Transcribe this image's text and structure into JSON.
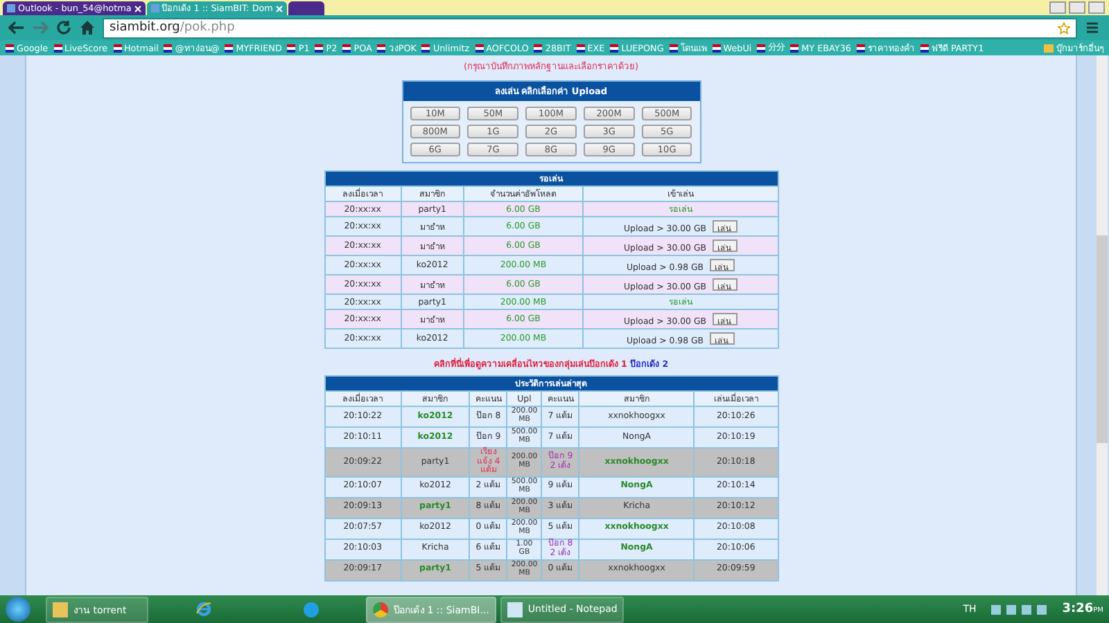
{
  "browser": {
    "tabs": [
      {
        "title": "Outlook - bun_54@hotma",
        "selected": false
      },
      {
        "title": "ป๊อกเด้ง 1 :: SiamBIT: Dom",
        "selected": true
      },
      {
        "selected": false
      }
    ],
    "url_host": "siambit.org",
    "url_path": "/pok.php",
    "bookmarks": [
      "Google",
      "LiveScore",
      "Hotmail",
      "@ทาง่อน@",
      "MYFRIEND",
      "P1",
      "P2",
      "POA",
      "วงPOK",
      "Unlimitz",
      "AOFCOLO",
      "28BIT",
      "EXE",
      "LUEPONG",
      "โดนแพ",
      "WebUi",
      "分分",
      "MY EBAY36",
      "ราคาทองคำ",
      "ฟรีดี PARTY1"
    ],
    "other_bookmarks": "บุ๊กมาร์กอื่นๆ"
  },
  "notice": "(กรุณาบันทึกภาพหลักฐานและเลือกราคาด้วย)",
  "upload_panel": {
    "title": "ลงเล่น คลิกเลือกค่า Upload",
    "options": [
      "10M",
      "50M",
      "100M",
      "200M",
      "500M",
      "800M",
      "1G",
      "2G",
      "3G",
      "5G",
      "6G",
      "7G",
      "8G",
      "9G",
      "10G"
    ]
  },
  "waiting_table": {
    "title": "รอเล่น",
    "columns": [
      "ลงเมื่อเวลา",
      "สมาชิก",
      "จำนวนค่าอัพโหลด",
      "เข้าเล่น"
    ],
    "rows": [
      {
        "time": "20:xx:xx",
        "member": "party1",
        "amount": "6.00 GB",
        "kind": "status",
        "status": "รอเล่น"
      },
      {
        "time": "20:xx:xx",
        "member": "มาธำห",
        "amount": "6.00 GB",
        "kind": "join",
        "requirement": "Upload > 30.00 GB",
        "button": "เล่น"
      },
      {
        "time": "20:xx:xx",
        "member": "มาธำห",
        "amount": "6.00 GB",
        "kind": "join",
        "requirement": "Upload > 30.00 GB",
        "button": "เล่น"
      },
      {
        "time": "20:xx:xx",
        "member": "ko2012",
        "amount": "200.00 MB",
        "kind": "join",
        "requirement": "Upload > 0.98 GB",
        "button": "เล่น"
      },
      {
        "time": "20:xx:xx",
        "member": "มาธำห",
        "amount": "6.00 GB",
        "kind": "join",
        "requirement": "Upload > 30.00 GB",
        "button": "เล่น"
      },
      {
        "time": "20:xx:xx",
        "member": "party1",
        "amount": "200.00 MB",
        "kind": "status",
        "status": "รอเล่น"
      },
      {
        "time": "20:xx:xx",
        "member": "มาธำห",
        "amount": "6.00 GB",
        "kind": "join",
        "requirement": "Upload > 30.00 GB",
        "button": "เล่น"
      },
      {
        "time": "20:xx:xx",
        "member": "ko2012",
        "amount": "200.00 MB",
        "kind": "join",
        "requirement": "Upload > 0.98 GB",
        "button": "เล่น"
      }
    ]
  },
  "group_link": {
    "text": "คลิกที่นี่เพื่อดูความเคลื่อนไหวของกลุ่มเล่นป๊อกเด้ง 1",
    "link": "ป๊อกเด้ง 2"
  },
  "history_table": {
    "title": "ประวัติการเล่นล่าสุด",
    "columns": [
      "ลงเมื่อเวลา",
      "สมาชิก",
      "คะแนน",
      "Upl",
      "คะแนน",
      "สมาชิก",
      "เล่นเมื่อเวลา"
    ],
    "rows": [
      {
        "time": "20:10:22",
        "member": "ko2012",
        "score": {
          "text": "ป๊อก 8",
          "color": "#333333"
        },
        "upload": "200.00 MB",
        "opponent_score": {
          "text": "7 แต้ม",
          "color": "#333333"
        },
        "opponent": "xxnokhoogxx",
        "played": "20:10:26",
        "member_won": true,
        "opponent_won": false,
        "highlighted": false
      },
      {
        "time": "20:10:11",
        "member": "ko2012",
        "score": {
          "text": "ป๊อก 9",
          "color": "#333333"
        },
        "upload": "500.00 MB",
        "opponent_score": {
          "text": "7 แต้ม",
          "color": "#333333"
        },
        "opponent": "NongA",
        "played": "20:10:19",
        "member_won": true,
        "opponent_won": false,
        "highlighted": false
      },
      {
        "time": "20:09:22",
        "member": "party1",
        "score": {
          "text": "เรียง แจ้ง 4 แต้ม",
          "color": "#e0305a"
        },
        "upload": "200.00 MB",
        "opponent_score": {
          "text": "ป๊อก 9 2 เด้ง",
          "color": "#a030b0"
        },
        "opponent": "xxnokhoogxx",
        "played": "20:10:18",
        "member_won": false,
        "opponent_won": true,
        "highlighted": true
      },
      {
        "time": "20:10:07",
        "member": "ko2012",
        "score": {
          "text": "2 แต้ม",
          "color": "#333333"
        },
        "upload": "500.00 MB",
        "opponent_score": {
          "text": "9 แต้ม",
          "color": "#333333"
        },
        "opponent": "NongA",
        "played": "20:10:14",
        "member_won": false,
        "opponent_won": true,
        "highlighted": false
      },
      {
        "time": "20:09:13",
        "member": "party1",
        "score": {
          "text": "8 แต้ม",
          "color": "#333333"
        },
        "upload": "200.00 MB",
        "opponent_score": {
          "text": "3 แต้ม",
          "color": "#333333"
        },
        "opponent": "Kricha",
        "played": "20:10:12",
        "member_won": true,
        "opponent_won": false,
        "highlighted": true
      },
      {
        "time": "20:07:57",
        "member": "ko2012",
        "score": {
          "text": "0 แต้ม",
          "color": "#333333"
        },
        "upload": "200.00 MB",
        "opponent_score": {
          "text": "5 แต้ม",
          "color": "#333333"
        },
        "opponent": "xxnokhoogxx",
        "played": "20:10:08",
        "member_won": false,
        "opponent_won": true,
        "highlighted": false
      },
      {
        "time": "20:10:03",
        "member": "Kricha",
        "score": {
          "text": "6 แต้ม",
          "color": "#333333"
        },
        "upload": "1.00 GB",
        "opponent_score": {
          "text": "ป๊อก 8 2 เด้ง",
          "color": "#a030b0"
        },
        "opponent": "NongA",
        "played": "20:10:06",
        "member_won": false,
        "opponent_won": true,
        "highlighted": false
      },
      {
        "time": "20:09:17",
        "member": "party1",
        "score": {
          "text": "5 แต้ม",
          "color": "#333333"
        },
        "upload": "200.00 MB",
        "opponent_score": {
          "text": "0 แต้ม",
          "color": "#333333"
        },
        "opponent": "xxnokhoogxx",
        "played": "20:09:59",
        "member_won": true,
        "opponent_won": false,
        "highlighted": true
      }
    ]
  },
  "taskbar": {
    "items": [
      {
        "label": "งาน torrent",
        "kind": "folder",
        "selected": false
      },
      {
        "kind": "ie",
        "selected": false
      },
      {
        "kind": "skype",
        "selected": false
      },
      {
        "label": "ป๊อกเด้ง 1 :: SiamBI...",
        "kind": "chrome",
        "selected": true
      },
      {
        "label": "Untitled - Notepad",
        "kind": "notepad",
        "selected": false
      }
    ],
    "language": "TH",
    "time": "3:26",
    "ampm": "PM"
  }
}
